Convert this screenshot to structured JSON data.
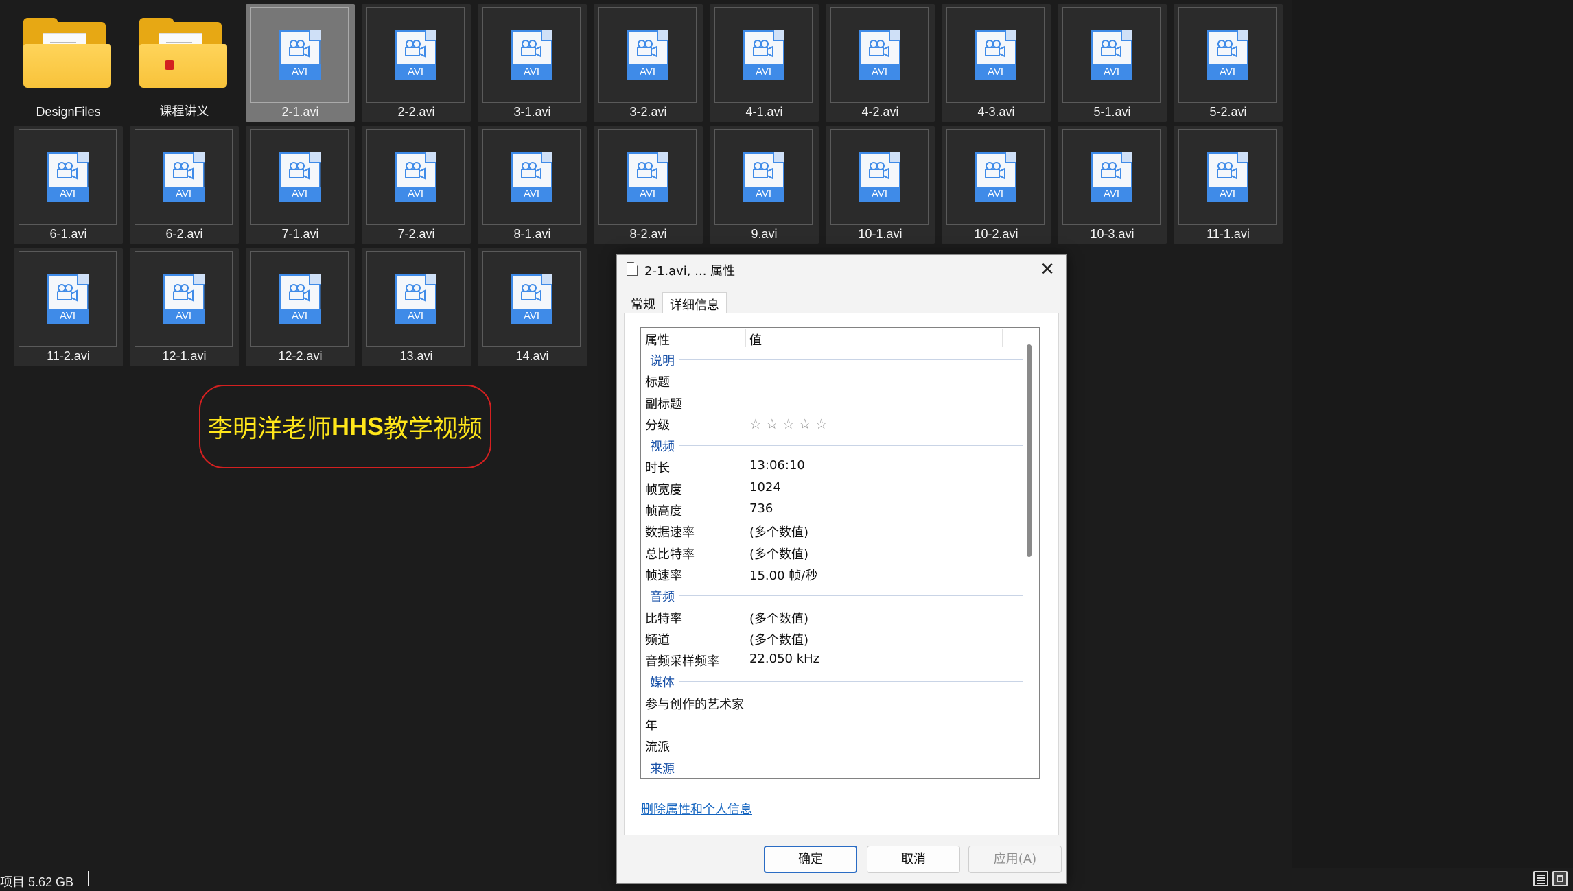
{
  "explorer": {
    "items": [
      {
        "name": "DesignFiles",
        "kind": "folder",
        "mark": false
      },
      {
        "name": "课程讲义",
        "kind": "folder",
        "mark": true
      },
      {
        "name": "2-1.avi",
        "kind": "avi",
        "selected": true
      },
      {
        "name": "2-2.avi",
        "kind": "avi"
      },
      {
        "name": "3-1.avi",
        "kind": "avi"
      },
      {
        "name": "3-2.avi",
        "kind": "avi"
      },
      {
        "name": "4-1.avi",
        "kind": "avi"
      },
      {
        "name": "4-2.avi",
        "kind": "avi"
      },
      {
        "name": "4-3.avi",
        "kind": "avi"
      },
      {
        "name": "5-1.avi",
        "kind": "avi"
      },
      {
        "name": "5-2.avi",
        "kind": "avi"
      },
      {
        "name": "6-1.avi",
        "kind": "avi"
      },
      {
        "name": "6-2.avi",
        "kind": "avi"
      },
      {
        "name": "7-1.avi",
        "kind": "avi"
      },
      {
        "name": "7-2.avi",
        "kind": "avi"
      },
      {
        "name": "8-1.avi",
        "kind": "avi"
      },
      {
        "name": "8-2.avi",
        "kind": "avi"
      },
      {
        "name": "9.avi",
        "kind": "avi"
      },
      {
        "name": "10-1.avi",
        "kind": "avi"
      },
      {
        "name": "10-2.avi",
        "kind": "avi"
      },
      {
        "name": "10-3.avi",
        "kind": "avi"
      },
      {
        "name": "11-1.avi",
        "kind": "avi"
      },
      {
        "name": "11-2.avi",
        "kind": "avi"
      },
      {
        "name": "12-1.avi",
        "kind": "avi"
      },
      {
        "name": "12-2.avi",
        "kind": "avi"
      },
      {
        "name": "13.avi",
        "kind": "avi"
      },
      {
        "name": "14.avi",
        "kind": "avi"
      }
    ],
    "file_badge": "AVI",
    "icons": {
      "folder": "folder-icon",
      "avi": "avi-video-file-icon"
    }
  },
  "banner": {
    "part1": "李明洋老师",
    "part2": "HHS",
    "part3": "教学视频",
    "text_color": "#ffe61a",
    "border_color": "#d42020"
  },
  "status": {
    "text": "项目  5.62 GB"
  },
  "dialog": {
    "title": "2-1.avi, ... 属性",
    "tabs": [
      "常规",
      "详细信息"
    ],
    "active_tab": 1,
    "header": {
      "property": "属性",
      "value": "值"
    },
    "rows": [
      {
        "type": "group",
        "label": "说明"
      },
      {
        "type": "row",
        "property": "标题",
        "value": ""
      },
      {
        "type": "row",
        "property": "副标题",
        "value": ""
      },
      {
        "type": "row",
        "property": "分级",
        "value": "☆☆☆☆☆",
        "stars": true
      },
      {
        "type": "group",
        "label": "视频"
      },
      {
        "type": "row",
        "property": "时长",
        "value": "13:06:10"
      },
      {
        "type": "row",
        "property": "帧宽度",
        "value": "1024"
      },
      {
        "type": "row",
        "property": "帧高度",
        "value": "736"
      },
      {
        "type": "row",
        "property": "数据速率",
        "value": "(多个数值)"
      },
      {
        "type": "row",
        "property": "总比特率",
        "value": "(多个数值)"
      },
      {
        "type": "row",
        "property": "帧速率",
        "value": "15.00 帧/秒"
      },
      {
        "type": "group",
        "label": "音频"
      },
      {
        "type": "row",
        "property": "比特率",
        "value": "(多个数值)"
      },
      {
        "type": "row",
        "property": "频道",
        "value": "(多个数值)"
      },
      {
        "type": "row",
        "property": "音频采样频率",
        "value": "22.050 kHz"
      },
      {
        "type": "group",
        "label": "媒体"
      },
      {
        "type": "row",
        "property": "参与创作的艺术家",
        "value": ""
      },
      {
        "type": "row",
        "property": "年",
        "value": ""
      },
      {
        "type": "row",
        "property": "流派",
        "value": ""
      },
      {
        "type": "group",
        "label": "来源"
      }
    ],
    "remove_link": "删除属性和个人信息",
    "buttons": {
      "ok": "确定",
      "cancel": "取消",
      "apply": "应用(A)"
    },
    "close_glyph": "✕",
    "accent": "#2a6cc4"
  }
}
